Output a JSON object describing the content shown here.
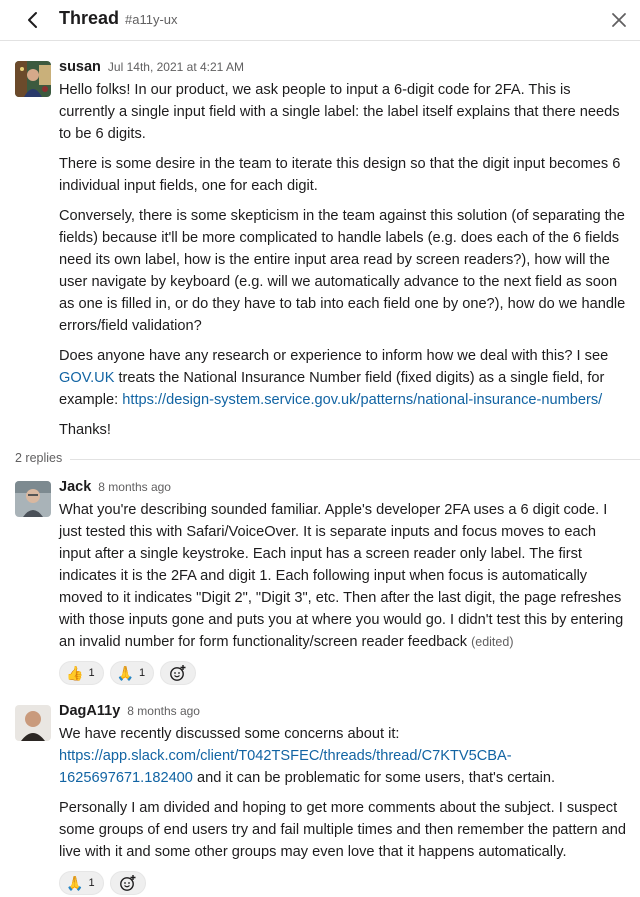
{
  "header": {
    "title": "Thread",
    "channel": "#a11y-ux",
    "back_icon": "chevron-left-icon",
    "close_icon": "close-icon"
  },
  "messages": [
    {
      "author": "susan",
      "time": "Jul 14th, 2021 at 4:21 AM",
      "avatar_color": "#2e4c3a",
      "paragraphs": [
        "Hello folks! In our product, we ask people to input a 6-digit code for 2FA. This is currently a single input field with a single label: the label itself explains that there needs to be 6 digits.",
        "There is some desire in the team to iterate this design so that the digit input becomes 6 individual input fields, one for each digit.",
        "Conversely, there is some skepticism in the team against this solution (of separating the fields) because it'll be more complicated to handle labels (e.g. does each of the 6 fields need its own label, how is the entire input area read by screen readers?), how will the user navigate by keyboard (e.g. will we automatically advance to the next field as soon as one is filled in, or do they have to tab into each field one by one?), how do we handle errors/field validation?"
      ],
      "p4_before": "Does anyone have any research or experience to inform how we deal with this? I see ",
      "p4_link1": "GOV.UK",
      "p4_middle": " treats the National Insurance Number field (fixed digits) as a single field, for example: ",
      "p4_link2": "https://design-system.service.gov.uk/patterns/national-insurance-numbers/",
      "thanks": "Thanks!"
    },
    {
      "author": "Jack",
      "time": "8 months ago",
      "avatar_color": "#8a8f94",
      "text": "What you're describing sounded familiar. Apple's developer 2FA uses a 6 digit code. I just tested this with Safari/VoiceOver. It is separate inputs and focus moves to each input after a single keystroke. Each input has a screen reader only label. The first indicates it is the 2FA and digit 1. Each following input when focus is automatically moved to it indicates \"Digit 2\", \"Digit 3\", etc. Then after the last digit, the page refreshes with those inputs gone and puts you at where you would go. I didn't test this by entering an invalid number for form functionality/screen reader feedback",
      "edited": "(edited)",
      "reactions": [
        {
          "emoji": "👍",
          "count": "1"
        },
        {
          "emoji": "🙏",
          "count": "1"
        }
      ],
      "add_reaction_icon": "add-reaction-icon"
    },
    {
      "author": "DagA11y",
      "time": "8 months ago",
      "avatar_color": "#3a2a22",
      "p1_before": "We have recently discussed some concerns about it: ",
      "p1_link": "https://app.slack.com/client/T042TSFEC/threads/thread/C7KTV5CBA-1625697671.182400",
      "p1_after": " and it can be problematic for some users, that's certain.",
      "p2": "Personally I am divided and hoping to get more comments about the subject. I suspect some groups of end users try and fail multiple times and then remember the pattern and live with it and some other groups may even love that it happens automatically.",
      "reactions": [
        {
          "emoji": "🙏",
          "count": "1"
        }
      ],
      "add_reaction_icon": "add-reaction-icon"
    }
  ],
  "replies_label": "2 replies"
}
